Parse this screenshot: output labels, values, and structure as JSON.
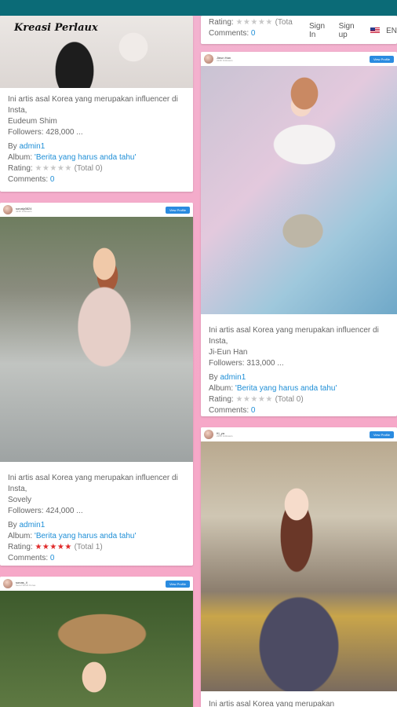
{
  "nav": {
    "sign_in": "Sign In",
    "sign_up": "Sign up",
    "lang": "EN"
  },
  "brand_script": "Kreasi Perlaux",
  "labels": {
    "by": "By",
    "album": "Album:",
    "rating": "Rating:",
    "comments": "Comments:",
    "view_profile": "View Profile",
    "intro": "Ini artis asal Korea yang merupakan influencer di Insta,"
  },
  "cards": [
    {
      "name": "Eudeum Shim",
      "followers": "Followers: 428,000 ...",
      "author": "admin1",
      "album": "'Berita yang harus anda tahu'",
      "stars": "★★★★★",
      "total": "(Total 0)",
      "comments": "0"
    },
    {
      "head_name": "sonaly0824",
      "head_sub": "424K Followers",
      "name": "Sovely",
      "followers": "Followers: 424,000 ...",
      "author": "admin1",
      "album": "'Berita yang harus anda tahu'",
      "stars": "★★★★★",
      "total": "(Total 1)",
      "comments": "0"
    },
    {
      "head_name": "sonas_ii",
      "head_sub": "Seoul South Korea",
      "name": "",
      "followers": "",
      "author": "",
      "album": "",
      "stars": "",
      "total": "",
      "comments": ""
    },
    {
      "head_name": "Jieun Han",
      "head_sub": "313K Followers",
      "name": "Ji-Eun Han",
      "followers": "Followers: 313,000 ...",
      "author": "admin1",
      "album": "'Berita yang harus anda tahu'",
      "stars": "★★★★★",
      "total": "(Total 0)",
      "comments": "0"
    },
    {
      "head_name": "Ki_ya",
      "head_sub": "226K Followers",
      "name": "",
      "followers": "",
      "author": "",
      "album": "",
      "stars": "",
      "total": "",
      "comments": ""
    }
  ],
  "partial_top_right": {
    "rating_total": "(Tota",
    "comments": "0"
  },
  "partial_bottom_right": "Ini artis asal Korea yang merupakan",
  "colors": {
    "topbar": "#0b6b77",
    "link": "#1f8fd7",
    "star_active": "#e02a2a",
    "star_inactive": "#c8c8c8",
    "button": "#2a8be0"
  }
}
